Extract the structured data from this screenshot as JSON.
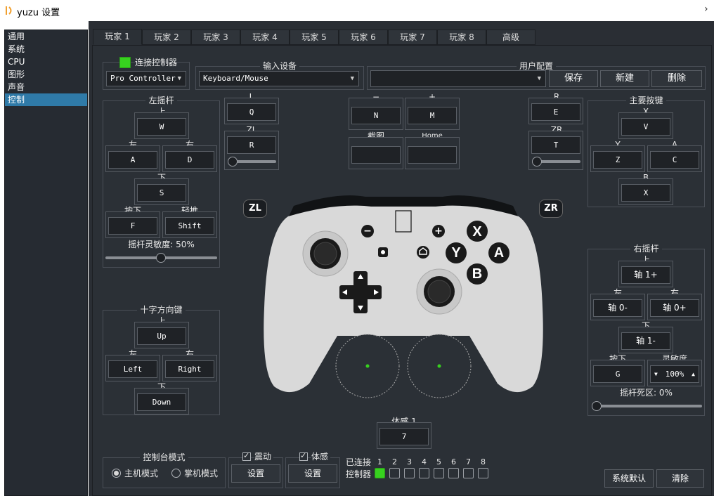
{
  "window": {
    "title": "yuzu 设置",
    "close": "›"
  },
  "sidebar": {
    "items": [
      "通用",
      "系统",
      "CPU",
      "图形",
      "声音",
      "控制"
    ],
    "selected": "控制"
  },
  "tabs": [
    "玩家 1",
    "玩家 2",
    "玩家 3",
    "玩家 4",
    "玩家 5",
    "玩家 6",
    "玩家 7",
    "玩家 8",
    "高级"
  ],
  "connect": {
    "label": "连接控制器",
    "type": "Pro Controller"
  },
  "input_device": {
    "title": "输入设备",
    "value": "Keyboard/Mouse"
  },
  "profile": {
    "title": "用户配置",
    "value": "",
    "save": "保存",
    "new": "新建",
    "delete": "删除"
  },
  "left_stick": {
    "title": "左摇杆",
    "up_label": "上",
    "up": "W",
    "left_label": "左",
    "left": "A",
    "right_label": "右",
    "right": "D",
    "down_label": "下",
    "down": "S",
    "press_label": "按下",
    "press": "F",
    "modifier_label": "轻推",
    "modifier": "Shift",
    "sensitivity_label": "摇杆灵敏度: 50%",
    "sensitivity_value": 50
  },
  "dpad": {
    "title": "十字方向键",
    "up_label": "上",
    "up": "Up",
    "left_label": "左",
    "left": "Left",
    "right_label": "右",
    "right": "Right",
    "down_label": "下",
    "down": "Down"
  },
  "shoulders_left": {
    "l_label": "L",
    "l": "Q",
    "zl_label": "ZL",
    "zl": "R",
    "zl_range_value": 0
  },
  "misc": {
    "minus_label": "−",
    "minus": "N",
    "plus_label": "+",
    "plus": "M",
    "capture_label": "截图",
    "capture": "",
    "home_label": "Home",
    "home": ""
  },
  "shoulders_right": {
    "r_label": "R",
    "r": "E",
    "zr_label": "ZR",
    "zr": "T",
    "zr_range_value": 0
  },
  "face": {
    "title": "主要按键",
    "x_label": "X",
    "x": "V",
    "y_label": "Y",
    "y": "Z",
    "a_label": "A",
    "a": "C",
    "b_label": "B",
    "b": "X"
  },
  "controller_image": {
    "zl": "ZL",
    "zr": "ZR",
    "x": "X",
    "y": "Y",
    "a": "A",
    "b": "B",
    "minus": "−",
    "plus": "+"
  },
  "right_stick": {
    "title": "右摇杆",
    "up_label": "上",
    "up": "轴 1+",
    "left_label": "左",
    "left": "轴 0-",
    "right_label": "右",
    "right": "轴 0+",
    "down_label": "下",
    "down": "轴 1-",
    "press_label": "按下",
    "press": "G",
    "sens_label": "灵敏度",
    "sens": "100%",
    "deadzone_label": "摇杆死区: 0%",
    "deadzone_value": 0
  },
  "motion": {
    "title": "体感 1",
    "value": "7"
  },
  "console_mode": {
    "title": "控制台模式",
    "docked": "主机模式",
    "handheld": "掌机模式",
    "selected": "docked"
  },
  "vibration": {
    "label": "震动",
    "button": "设置",
    "checked": true
  },
  "motion_enable": {
    "label": "体感",
    "button": "设置",
    "checked": true
  },
  "connected": {
    "label1": "已连接",
    "label2": "控制器",
    "numbers": [
      "1",
      "2",
      "3",
      "4",
      "5",
      "6",
      "7",
      "8"
    ],
    "states": [
      true,
      false,
      false,
      false,
      false,
      false,
      false,
      false
    ]
  },
  "footer": {
    "defaults": "系统默认",
    "clear": "清除"
  },
  "colors": {
    "accent_green": "#37d11f",
    "selection": "#2f7aa8",
    "background": "#2b3036"
  }
}
